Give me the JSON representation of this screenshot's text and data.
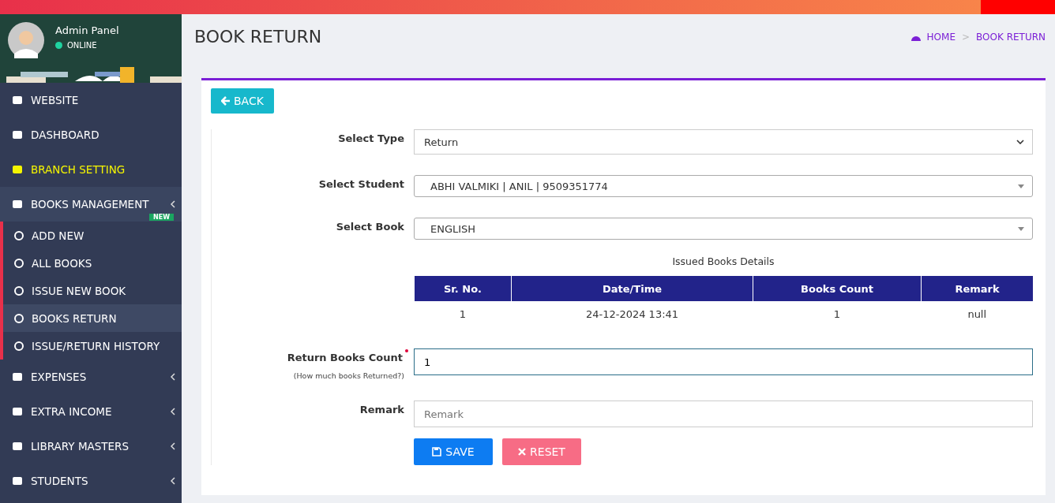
{
  "user": {
    "name": "Admin Panel",
    "status": "ONLINE"
  },
  "sidebar": {
    "items": [
      {
        "label": "WEBSITE",
        "active": false,
        "expandable": false
      },
      {
        "label": "DASHBOARD",
        "active": false,
        "expandable": false
      },
      {
        "label": "BRANCH SETTING",
        "active": true,
        "expandable": false
      },
      {
        "label": "BOOKS MANAGEMENT",
        "active": false,
        "expandable": true,
        "expanded": true,
        "badge": "NEW",
        "children": [
          {
            "label": "ADD NEW",
            "selected": false
          },
          {
            "label": "ALL BOOKS",
            "selected": false
          },
          {
            "label": "ISSUE NEW BOOK",
            "selected": false
          },
          {
            "label": "BOOKS RETURN",
            "selected": true
          },
          {
            "label": "ISSUE/RETURN HISTORY",
            "selected": false
          }
        ]
      },
      {
        "label": "EXPENSES",
        "active": false,
        "expandable": true
      },
      {
        "label": "EXTRA INCOME",
        "active": false,
        "expandable": true
      },
      {
        "label": "LIBRARY MASTERS",
        "active": false,
        "expandable": true
      },
      {
        "label": "STUDENTS",
        "active": false,
        "expandable": true
      }
    ]
  },
  "page": {
    "title": "BOOK RETURN",
    "breadcrumb": [
      "HOME",
      "BOOK RETURN"
    ],
    "breadcrumb_separator": ">"
  },
  "back_button": "BACK",
  "form": {
    "fields": [
      {
        "kind": "select",
        "label": "Select Type",
        "value": "Return"
      },
      {
        "kind": "combo",
        "label": "Select Student",
        "value": "ABHI VALMIKI | ANIL | 9509351774"
      },
      {
        "kind": "combo",
        "label": "Select Book",
        "value": "ENGLISH"
      }
    ]
  },
  "issued_table": {
    "caption": "Issued Books Details",
    "columns": [
      "Sr. No.",
      "Date/Time",
      "Books Count",
      "Remark"
    ],
    "rows": [
      [
        "1",
        "24-12-2024 13:41",
        "1",
        "null"
      ]
    ]
  },
  "return_count": {
    "label": "Return Books Count",
    "required": true,
    "hint": "(How much books Returned?)",
    "value": "1"
  },
  "remark": {
    "label": "Remark",
    "placeholder": "Remark"
  },
  "buttons": [
    {
      "kind": "save",
      "label": "SAVE"
    },
    {
      "kind": "reset",
      "label": "RESET"
    }
  ]
}
